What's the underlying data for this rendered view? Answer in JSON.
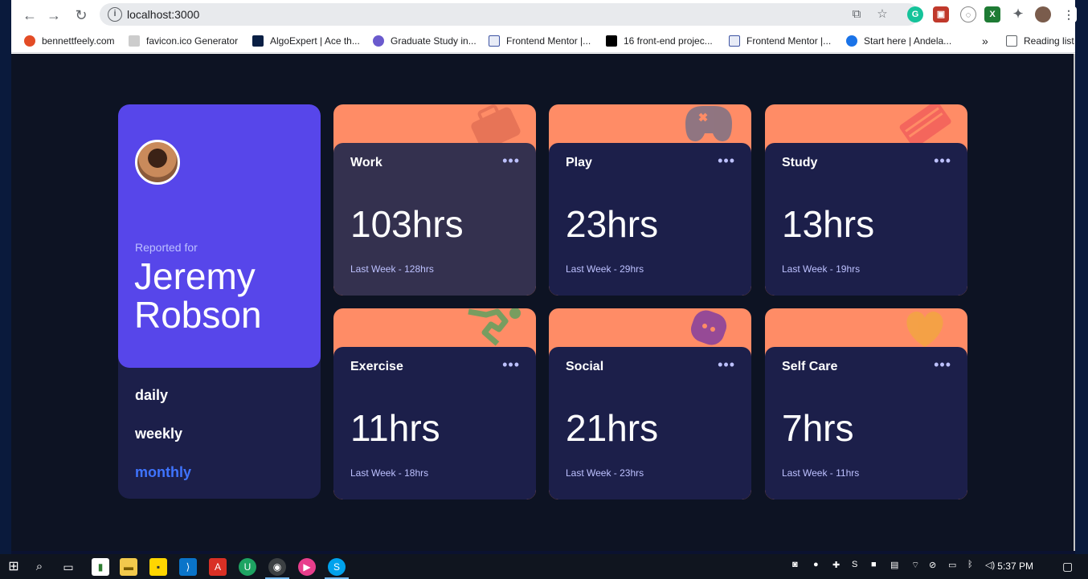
{
  "browser": {
    "url": "localhost:3000",
    "bookmarks": [
      {
        "label": "bennettfeely.com",
        "color": "#e34c26"
      },
      {
        "label": "favicon.ico Generator",
        "color": "#888888"
      },
      {
        "label": "AlgoExpert | Ace th...",
        "color": "#0a1f44"
      },
      {
        "label": "Graduate Study in...",
        "color": "#6a5acd"
      },
      {
        "label": "Frontend Mentor |...",
        "color": "#3e54a3"
      },
      {
        "label": "16 front-end projec...",
        "color": "#000000"
      },
      {
        "label": "Frontend Mentor |...",
        "color": "#3e54a3"
      },
      {
        "label": "Start here | Andela...",
        "color": "#1a73e8"
      }
    ],
    "more_label": "»",
    "reading_list": "Reading list"
  },
  "profile": {
    "reported_for": "Reported for",
    "name": "Jeremy Robson",
    "periods": [
      {
        "label": "daily",
        "active": false
      },
      {
        "label": "weekly",
        "active": false
      },
      {
        "label": "monthly",
        "active": true
      }
    ]
  },
  "cards": [
    {
      "title": "Work",
      "hours": "103hrs",
      "last": "Last Week - 128hrs",
      "color": "#ff8c66",
      "icon": "briefcase-icon"
    },
    {
      "title": "Play",
      "hours": "23hrs",
      "last": "Last Week - 29hrs",
      "color": "#ff8c66",
      "icon": "gamepad-icon"
    },
    {
      "title": "Study",
      "hours": "13hrs",
      "last": "Last Week - 19hrs",
      "color": "#ff8c66",
      "icon": "book-icon"
    },
    {
      "title": "Exercise",
      "hours": "11hrs",
      "last": "Last Week - 18hrs",
      "color": "#ff8c66",
      "icon": "runner-icon"
    },
    {
      "title": "Social",
      "hours": "21hrs",
      "last": "Last Week - 23hrs",
      "color": "#ff8c66",
      "icon": "chat-icon"
    },
    {
      "title": "Self Care",
      "hours": "7hrs",
      "last": "Last Week - 11hrs",
      "color": "#ff8c66",
      "icon": "heart-icon"
    }
  ],
  "menu_dots": "•••",
  "taskbar": {
    "clock": "5:37 PM"
  },
  "colors": {
    "page_bg": "#0d1323",
    "card_bg": "#1c1f4a",
    "accent_purple": "#5746ea",
    "active_link": "#3f74ff"
  }
}
